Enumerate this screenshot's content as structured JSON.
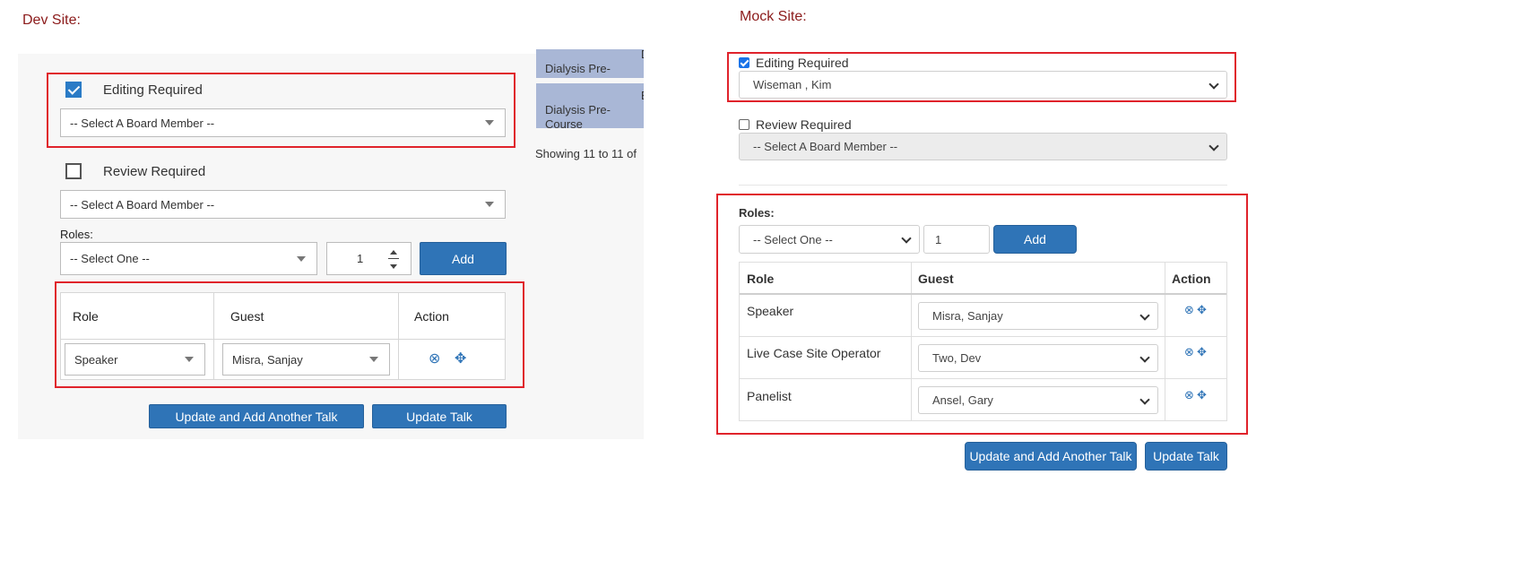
{
  "dev": {
    "title": "Dev Site:",
    "editing_label": "Editing Required",
    "editing_checked": true,
    "editing_select": "-- Select A Board Member --",
    "review_label": "Review Required",
    "review_checked": false,
    "review_select": "-- Select A Board Member --",
    "roles_label": "Roles:",
    "role_select": "-- Select One --",
    "qty_value": "1",
    "add_label": "Add",
    "table_headers": [
      "Role",
      "Guest",
      "Action"
    ],
    "rows": [
      {
        "role": "Speaker",
        "guest": "Misra, Sanjay"
      }
    ],
    "btn_update_add": "Update and Add Another Talk",
    "btn_update": "Update Talk",
    "peek_rows": [
      "Dialysis Pre-\nCourse",
      "Dialysis Pre-\nCourse"
    ],
    "peek_cut1": "D",
    "peek_cut2": "E",
    "showing_text": "Showing 11 to 11 of"
  },
  "mock": {
    "title": "Mock Site:",
    "editing_label": "Editing Required",
    "editing_checked": true,
    "editing_select": "Wiseman , Kim",
    "review_label": "Review Required",
    "review_checked": false,
    "review_select": "-- Select A Board Member --",
    "roles_label": "Roles:",
    "role_select": "-- Select One --",
    "qty_value": "1",
    "add_label": "Add",
    "table_headers": [
      "Role",
      "Guest",
      "Action"
    ],
    "rows": [
      {
        "role": "Speaker",
        "guest": "Misra, Sanjay"
      },
      {
        "role": "Live Case Site Operator",
        "guest": "Two, Dev"
      },
      {
        "role": "Panelist",
        "guest": "Ansel, Gary"
      }
    ],
    "btn_update_add": "Update and Add Another Talk",
    "btn_update": "Update Talk"
  },
  "icons": {
    "remove": "circle-x-icon",
    "move": "move-arrows-icon"
  },
  "colors": {
    "primary": "#2f74b7",
    "highlight": "#e0232b",
    "label": "#8b1a1a"
  }
}
